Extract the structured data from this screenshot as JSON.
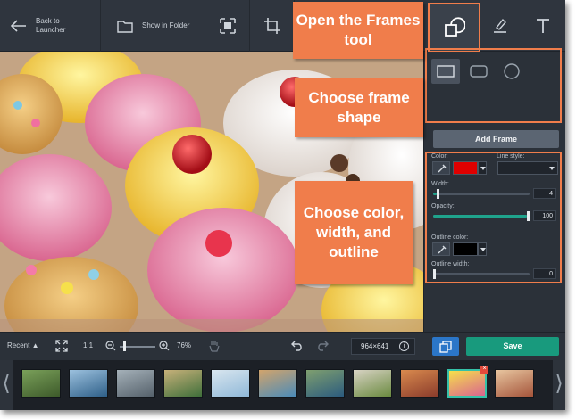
{
  "toolbar": {
    "back_label": "Back to Launcher",
    "show_in_folder_label": "Show in Folder",
    "icons": [
      "back-arrow-icon",
      "folder-icon",
      "crop-select-icon",
      "crop-icon",
      "frames-icon",
      "highlighter-icon",
      "text-icon"
    ]
  },
  "callouts": {
    "frames_tool": "Open the Frames tool",
    "frame_shape": "Choose frame shape",
    "color_width_outline": "Choose color, width, and outline"
  },
  "panel": {
    "shapes": [
      "rectangle",
      "rounded-rectangle",
      "circle"
    ],
    "selected_shape": "rectangle",
    "add_frame_label": "Add Frame",
    "color_label": "Color:",
    "color_value": "#e00000",
    "line_style_label": "Line style:",
    "width_label": "Width:",
    "width_value": "4",
    "width_fraction": 0.04,
    "opacity_label": "Opacity:",
    "opacity_value": "100",
    "opacity_fraction": 1.0,
    "outline_color_label": "Outline color:",
    "outline_color_value": "#000000",
    "outline_width_label": "Outline width:",
    "outline_width_value": "0",
    "outline_width_fraction": 0.0
  },
  "bottombar": {
    "recent_label": "Recent",
    "ratio_label": "1:1",
    "zoom_value": "76%",
    "zoom_fraction": 0.1,
    "dimensions": "964×641",
    "save_label": "Save"
  },
  "filmstrip": {
    "thumbnail_count": 11,
    "selected_index": 9
  },
  "colors": {
    "accent_callout": "#f07d4b",
    "save_button": "#189a7d",
    "copy_button": "#2b76c8",
    "slider_fill": "#1fa38c",
    "selected_thumb_border": "#35c1a8"
  }
}
